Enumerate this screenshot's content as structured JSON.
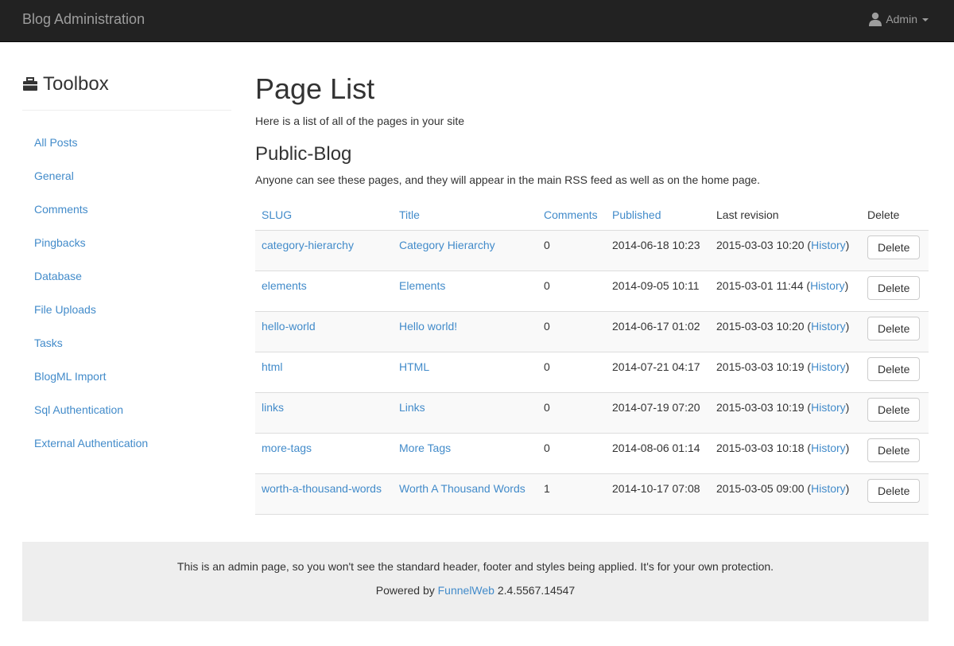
{
  "navbar": {
    "brand": "Blog Administration",
    "user": "Admin",
    "user_icon": "user-icon"
  },
  "sidebar": {
    "title": "Toolbox",
    "title_icon": "briefcase-icon",
    "items": [
      {
        "label": "All Posts"
      },
      {
        "label": "General"
      },
      {
        "label": "Comments"
      },
      {
        "label": "Pingbacks"
      },
      {
        "label": "Database"
      },
      {
        "label": "File Uploads"
      },
      {
        "label": "Tasks"
      },
      {
        "label": "BlogML Import"
      },
      {
        "label": "Sql Authentication"
      },
      {
        "label": "External Authentication"
      }
    ]
  },
  "main": {
    "title": "Page List",
    "intro": "Here is a list of all of the pages in your site",
    "section_title": "Public-Blog",
    "section_desc": "Anyone can see these pages, and they will appear in the main RSS feed as well as on the home page.",
    "columns": {
      "slug": "SLUG",
      "title": "Title",
      "comments": "Comments",
      "published": "Published",
      "last_revision": "Last revision",
      "delete": "Delete"
    },
    "history_label": "History",
    "delete_label": "Delete",
    "rows": [
      {
        "slug": "category-hierarchy",
        "title": "Category Hierarchy",
        "comments": "0",
        "published": "2014-06-18 10:23",
        "revision": "2015-03-03 10:20"
      },
      {
        "slug": "elements",
        "title": "Elements",
        "comments": "0",
        "published": "2014-09-05 10:11",
        "revision": "2015-03-01 11:44"
      },
      {
        "slug": "hello-world",
        "title": "Hello world!",
        "comments": "0",
        "published": "2014-06-17 01:02",
        "revision": "2015-03-03 10:20"
      },
      {
        "slug": "html",
        "title": "HTML",
        "comments": "0",
        "published": "2014-07-21 04:17",
        "revision": "2015-03-03 10:19"
      },
      {
        "slug": "links",
        "title": "Links",
        "comments": "0",
        "published": "2014-07-19 07:20",
        "revision": "2015-03-03 10:19"
      },
      {
        "slug": "more-tags",
        "title": "More Tags",
        "comments": "0",
        "published": "2014-08-06 01:14",
        "revision": "2015-03-03 10:18"
      },
      {
        "slug": "worth-a-thousand-words",
        "title": "Worth A Thousand Words",
        "comments": "1",
        "published": "2014-10-17 07:08",
        "revision": "2015-03-05 09:00"
      }
    ]
  },
  "footer": {
    "note": "This is an admin page, so you won't see the standard header, footer and styles being applied. It's for your own protection.",
    "powered_prefix": "Powered by ",
    "powered_link": "FunnelWeb",
    "version": " 2.4.5567.14547"
  }
}
